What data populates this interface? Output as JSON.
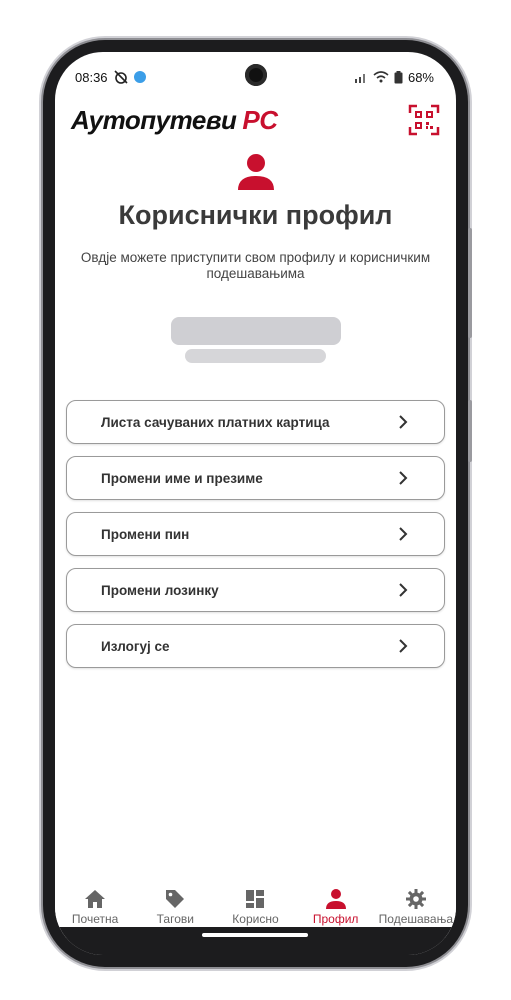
{
  "status_bar": {
    "time": "08:36",
    "battery": "68%"
  },
  "header": {
    "brand_main": "Аутопутеви",
    "brand_accent": "РС"
  },
  "page": {
    "title": "Кориснички профил",
    "description": "Овдје можете приступити свом профилу и корисничким подешавањима"
  },
  "menu": [
    {
      "label": "Листа сачуваних платних картица"
    },
    {
      "label": "Промени име и презиме"
    },
    {
      "label": "Промени пин"
    },
    {
      "label": "Промени лозинку"
    },
    {
      "label": "Излогуј се"
    }
  ],
  "bottom_nav": [
    {
      "label": "Почетна",
      "icon": "home-icon",
      "active": false
    },
    {
      "label": "Тагови",
      "icon": "tag-icon",
      "active": false
    },
    {
      "label": "Корисно",
      "icon": "dashboard-icon",
      "active": false
    },
    {
      "label": "Профил",
      "icon": "user-icon",
      "active": true
    },
    {
      "label": "Подешавања",
      "icon": "gear-icon",
      "active": false
    }
  ],
  "colors": {
    "accent": "#c8102e",
    "text": "#333333",
    "inactive_nav": "#666666"
  }
}
